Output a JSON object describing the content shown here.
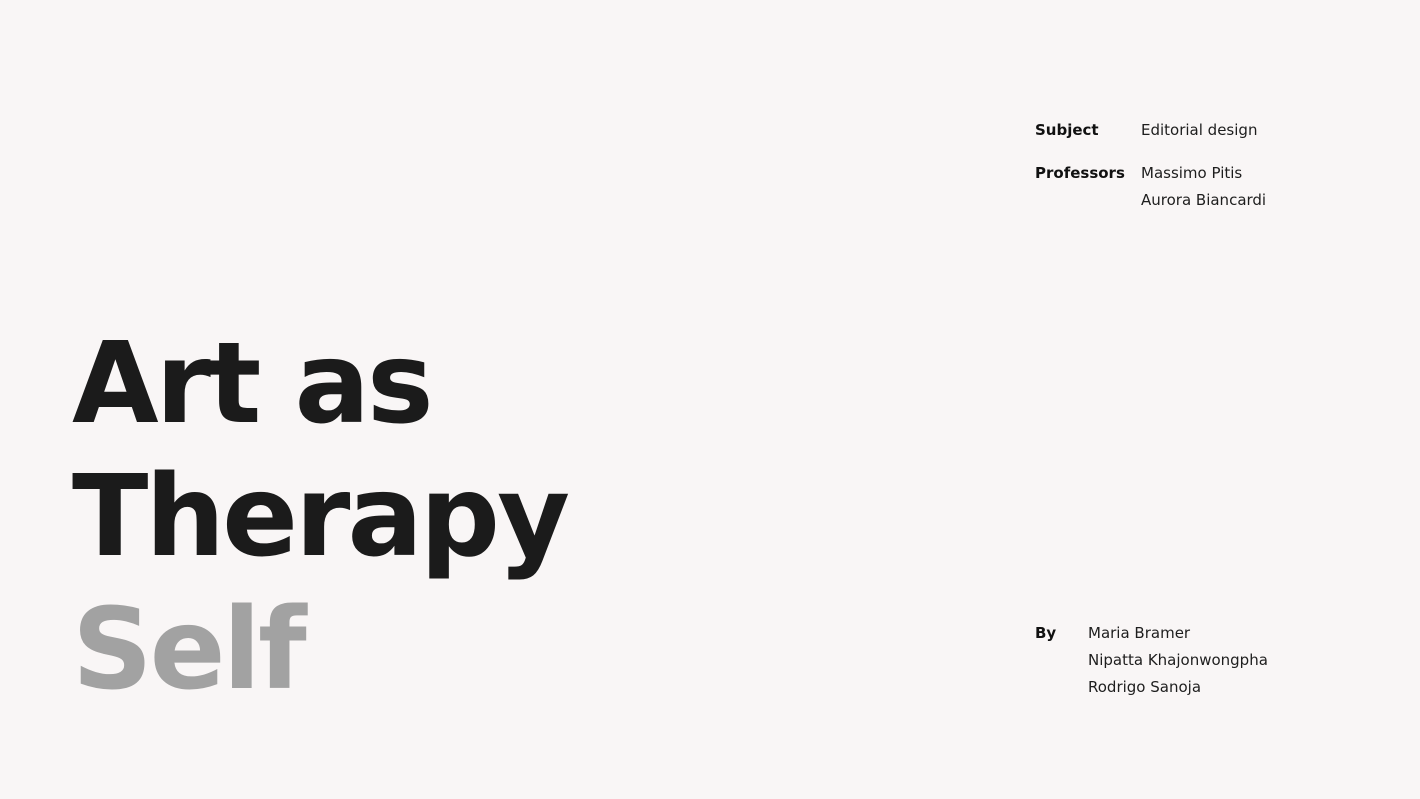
{
  "meta": {
    "subject_label": "Subject",
    "subject_value": "Editorial design",
    "professors_label": "Professors",
    "professors": [
      "Massimo Pitis",
      "Aurora Biancardi"
    ],
    "by_label": "By",
    "authors": [
      "Maria Bramer",
      "Nipatta Khajonwongpha",
      "Rodrigo Sanoja"
    ]
  },
  "title": {
    "line1": "Art as",
    "line2": "Therapy",
    "line3": "Self"
  },
  "colors": {
    "background": "#f9f6f6",
    "title_dark": "#1b1b1b",
    "title_grey": "#a2a2a2"
  }
}
